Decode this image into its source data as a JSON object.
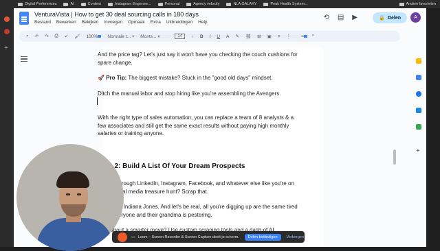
{
  "bookmarks": {
    "items": [
      "Digital Preferences",
      "AI",
      "Content",
      "Instagram Engenee...",
      "Personal",
      "Agency velocity",
      "NLA GALAXY",
      "Peak Health System..."
    ],
    "right": "Andere favorieten"
  },
  "doc": {
    "title": "VenturaVista | How to get 30 deal sourcing calls in 180 days",
    "menu": [
      "Bestand",
      "Bewerken",
      "Bekijken",
      "Invoegen",
      "Opmaak",
      "Extra",
      "Uitbreidingen",
      "Help"
    ]
  },
  "toolbar": {
    "zoom": "100%",
    "style": "Normale t...",
    "font": "Monts...",
    "size": "14",
    "minus": "−",
    "plus": "+"
  },
  "share": {
    "label": "Delen"
  },
  "avatar": {
    "initial": "A"
  },
  "content": {
    "p1": "And the price tag? Let's just say it won't have you checking the couch cushions for spare change.",
    "tip_emoji": "🚀",
    "tip_bold": "Pro Tip:",
    "tip_rest": " The biggest mistake? Stuck in the \"good old days\" mindset.",
    "p2": "Ditch the manual labor and stop hiring like you're assembling the Avengers.",
    "p3": "With the right type of sales automation, you can replace a team of 8 analysts & a few associates and still get the same exact results without paying high monthly salaries or training anyone.",
    "h2": "Step 2: Build A List Of Your Dream Prospects",
    "p4": "You sift through LinkedIn, Instagram, Facebook, and whatever else like you're on some social media treasure hunt? Scrap that.",
    "p5": "You're not Indiana Jones. And let's be real, all you're digging up are the same tired leads everyone and their grandma is pestering.",
    "p6": "How about a smarter move? Use custom scraping tools and a dash of AI"
  },
  "loom": {
    "text": "Loom – Screen Recorder & Screen Capture deelt je scherm.",
    "stop": "Delen beëindigen",
    "hide": "Verbergen"
  }
}
